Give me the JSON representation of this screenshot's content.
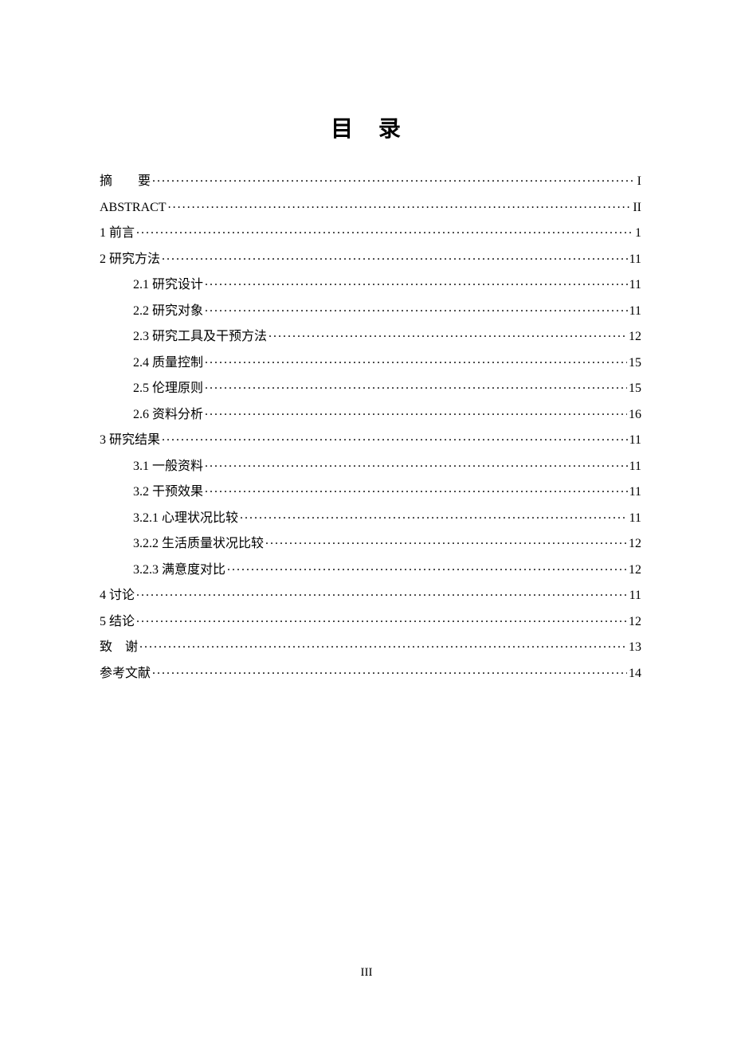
{
  "title": "目 录",
  "entries": [
    {
      "label": "摘  要",
      "page": "I",
      "indent": 0,
      "labelClass": "spaced"
    },
    {
      "label": "ABSTRACT ",
      "page": "II",
      "indent": 0,
      "labelClass": "abstract-label"
    },
    {
      "label": "1  前言",
      "page": "1",
      "indent": 0
    },
    {
      "label": "2  研究方法",
      "page": "11",
      "indent": 0
    },
    {
      "label": "2.1  研究设计",
      "page": "11",
      "indent": 1
    },
    {
      "label": "2.2 研究对象",
      "page": "11",
      "indent": 1
    },
    {
      "label": "2.3  研究工具及干预方法",
      "page": "12",
      "indent": 1
    },
    {
      "label": "2.4  质量控制",
      "page": "15",
      "indent": 1
    },
    {
      "label": "2.5  伦理原则",
      "page": "15",
      "indent": 1
    },
    {
      "label": "2.6  资料分析",
      "page": "16",
      "indent": 1
    },
    {
      "label": "3  研究结果",
      "page": "11",
      "indent": 0
    },
    {
      "label": "3.1  一般资料",
      "page": "11",
      "indent": 1
    },
    {
      "label": "3.2  干预效果",
      "page": "11",
      "indent": 1
    },
    {
      "label": "3.2.1 心理状况比较",
      "page": "11",
      "indent": 1
    },
    {
      "label": "3.2.2 生活质量状况比较",
      "page": "12",
      "indent": 1
    },
    {
      "label": "3.2.3  满意度对比",
      "page": "12",
      "indent": 1
    },
    {
      "label": "4  讨论",
      "page": "11",
      "indent": 0
    },
    {
      "label": "5  结论",
      "page": "12",
      "indent": 0
    },
    {
      "label": "致 谢",
      "page": "13",
      "indent": 0
    },
    {
      "label": "参考文献",
      "page": "14",
      "indent": 0
    }
  ],
  "pageNumber": "III"
}
